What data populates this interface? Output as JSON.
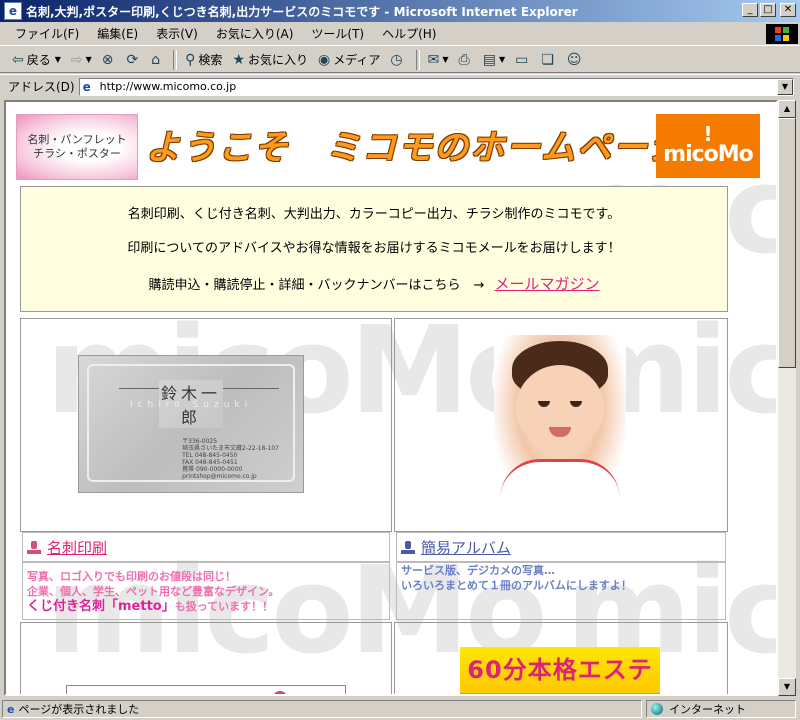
{
  "window": {
    "title": "名刺,大判,ポスター印刷,くじつき名刺,出力サービスのミコモです - Microsoft Internet Explorer",
    "minimize": "_",
    "maximize": "□",
    "close": "✕"
  },
  "menu": [
    "ファイル(F)",
    "編集(E)",
    "表示(V)",
    "お気に入り(A)",
    "ツール(T)",
    "ヘルプ(H)"
  ],
  "toolbar": {
    "back": "戻る",
    "search": "検索",
    "favorites": "お気に入り",
    "media": "メディア"
  },
  "address": {
    "label": "アドレス(D)",
    "url": "http://www.micomo.co.jp"
  },
  "page": {
    "banner_left_line1": "名刺・パンフレット",
    "banner_left_line2": "チラシ・ポスター",
    "banner_title": "ようこそ　ミコモのホームページへ！",
    "logo_text": "micoMo",
    "logo_mark": "!",
    "info_line1": "名刺印刷、くじ付き名刺、大判出力、カラーコピー出力、チラシ制作のミコモです。",
    "info_line2": "印刷についてのアドバイスやお得な情報をお届けするミコモメールをお届けします！",
    "info_line3": "購読申込・購読停止・詳細・バックナンバーはこちら　→",
    "mail_link": "メールマガジン",
    "card_name": "鈴木一郎",
    "card_romaji": "Ichiro Suzuki",
    "card_zip": "〒336-0025",
    "card_address": "埼玉県さいたま市文蔵2-22-18-107",
    "card_tel": "TEL 048-845-0450",
    "card_fax": "FAX 048-845-0451",
    "card_mobile": "携帯 090-0000-0000",
    "card_email": "printshop@micomo.co.jp",
    "meishi_title": "名刺印刷",
    "meishi_desc1": "写真、ロゴ入りでも印刷のお値段は同じ！",
    "meishi_desc2": "企業、個人、学生、ペット用など豊富なデザイン。",
    "meishi_desc3a": "くじ付き名刺「metto」",
    "meishi_desc3b": "も扱っています！！",
    "album_title": "簡易アルバム",
    "album_desc1": "サービス版、デジカメの写真…",
    "album_desc2": "いろいろまとめて１冊のアルバムにしますよ！",
    "esthe_banner": "60分本格エステ",
    "watermark": "micoMo"
  },
  "status": {
    "message": "ページが表示されました",
    "zone": "インターネット"
  }
}
